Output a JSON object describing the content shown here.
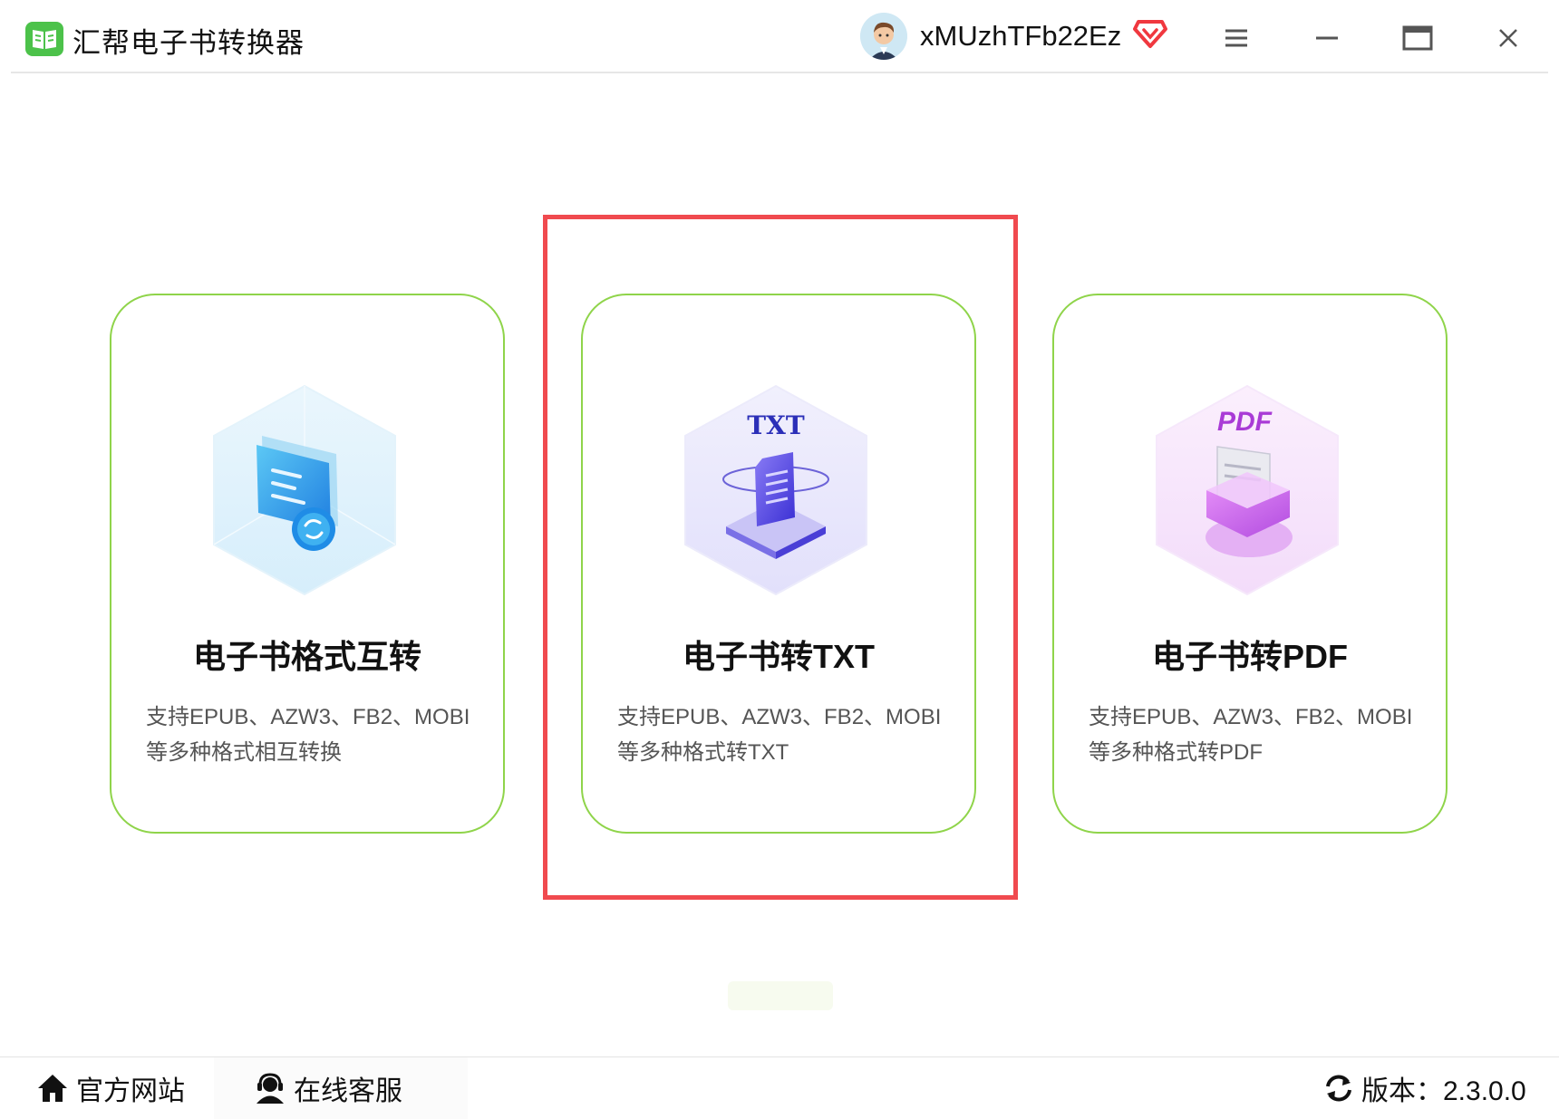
{
  "window": {
    "title": "汇帮电子书转换器",
    "username": "xMUzhTFb22Ez",
    "icons": [
      "book-logo-icon",
      "avatar",
      "vip-diamond-icon",
      "menu-icon",
      "minimize-icon",
      "maximize-icon",
      "close-icon"
    ]
  },
  "cards": [
    {
      "icon": "ebook-convert-icon",
      "title": "电子书格式互转",
      "desc_line1": "支持EPUB、AZW3、FB2、MOBI",
      "desc_line2": "等多种格式相互转换"
    },
    {
      "icon": "txt-document-icon",
      "badge": "TXT",
      "title": "电子书转TXT",
      "desc_line1": "支持EPUB、AZW3、FB2、MOBI",
      "desc_line2": "等多种格式转TXT"
    },
    {
      "icon": "pdf-tray-icon",
      "badge": "PDF",
      "title": "电子书转PDF",
      "desc_line1": "支持EPUB、AZW3、FB2、MOBI",
      "desc_line2": "等多种格式转PDF"
    }
  ],
  "colors": {
    "accent_green": "#4cc24a",
    "card_border": "#8fd44a",
    "highlight_red": "#f04a4f",
    "txt_badge": "#2b2fb8",
    "pdf_badge": "#a93bd6"
  },
  "footer": {
    "website": "官方网站",
    "support": "在线客服",
    "version": "版本：2.3.0.0"
  }
}
